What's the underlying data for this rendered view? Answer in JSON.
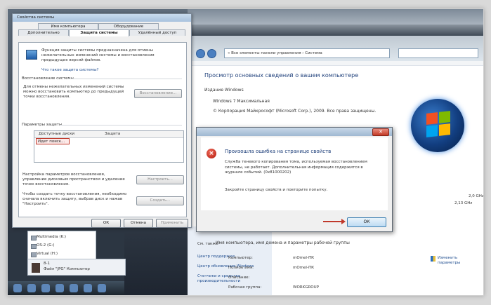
{
  "props": {
    "title": "Свойства системы",
    "tabs": [
      "Имя компьютера",
      "Оборудование",
      "Дополнительно",
      "Защита системы",
      "Удалённый доступ"
    ],
    "desc": "Функция защиты системы предназначена для отмены нежелательных изменений системы и восстановления предыдущих версий файлов.",
    "desc_link": "Что такое защита системы?",
    "restore_group": "Восстановление системы",
    "restore_text": "Для отмены нежелательных изменений системы можно восстановить компьютер до предыдущей точки восстановления.",
    "restore_button": "Восстановление...",
    "protect_group": "Параметры защиты",
    "table_headers": [
      "Доступные диски",
      "Защита"
    ],
    "table_row": "Идет поиск...",
    "config_text": "Настройка параметров восстановления, управление дисковым пространством и удаление точек восстановления.",
    "config_button": "Настроить...",
    "create_text": "Чтобы создать точку восстановления, необходимо сначала включить защиту, выбрав диск и нажав \"Настроить\".",
    "create_button": "Создать...",
    "ok": "ОК",
    "cancel": "Отмена",
    "apply": "Применить"
  },
  "error": {
    "heading": "Произошла ошибка на странице свойств",
    "message": "Служба теневого копирования тома, используемая восстановлением системы, не работает. Дополнительная информация содержится в журнале событий. (0x81000202)",
    "footer": "Закройте страницу свойств и повторите попытку.",
    "ok": "ОК",
    "close": "✕"
  },
  "system": {
    "address": "« Все элементы панели управления › Система",
    "heading": "Просмотр основных сведений о вашем компьютере",
    "edition_label": "Издание Windows",
    "edition": "Windows 7 Максимальная",
    "copyright": "© Корпорация Майкрософт (Microsoft Corp.), 2009. Все права защищены.",
    "cpu_speed": "2,0 GHz",
    "cpu_speed2": "2,13 GHz",
    "name_group": "Имя компьютера, имя домена и параметры рабочей группы",
    "rows": [
      {
        "label": "Компьютер:",
        "value": "mOmel-ПК"
      },
      {
        "label": "Полное имя:",
        "value": "mOmel-ПК"
      },
      {
        "label": "Описание:",
        "value": ""
      },
      {
        "label": "Рабочая группа:",
        "value": "WORKGROUP"
      }
    ],
    "change_link": "Изменить параметры",
    "side_title": "См. также",
    "side_links": [
      "Центр поддержки",
      "Центр обновления Windows",
      "Счетчики и средства производительности"
    ]
  },
  "explorer": {
    "items": [
      "Multimedia (K:)",
      "OS-2 (G:)",
      "Virtual (H:)"
    ],
    "thumb_title": "8-1",
    "thumb_sub": "Файл \"JPG\"  Компьютер"
  }
}
